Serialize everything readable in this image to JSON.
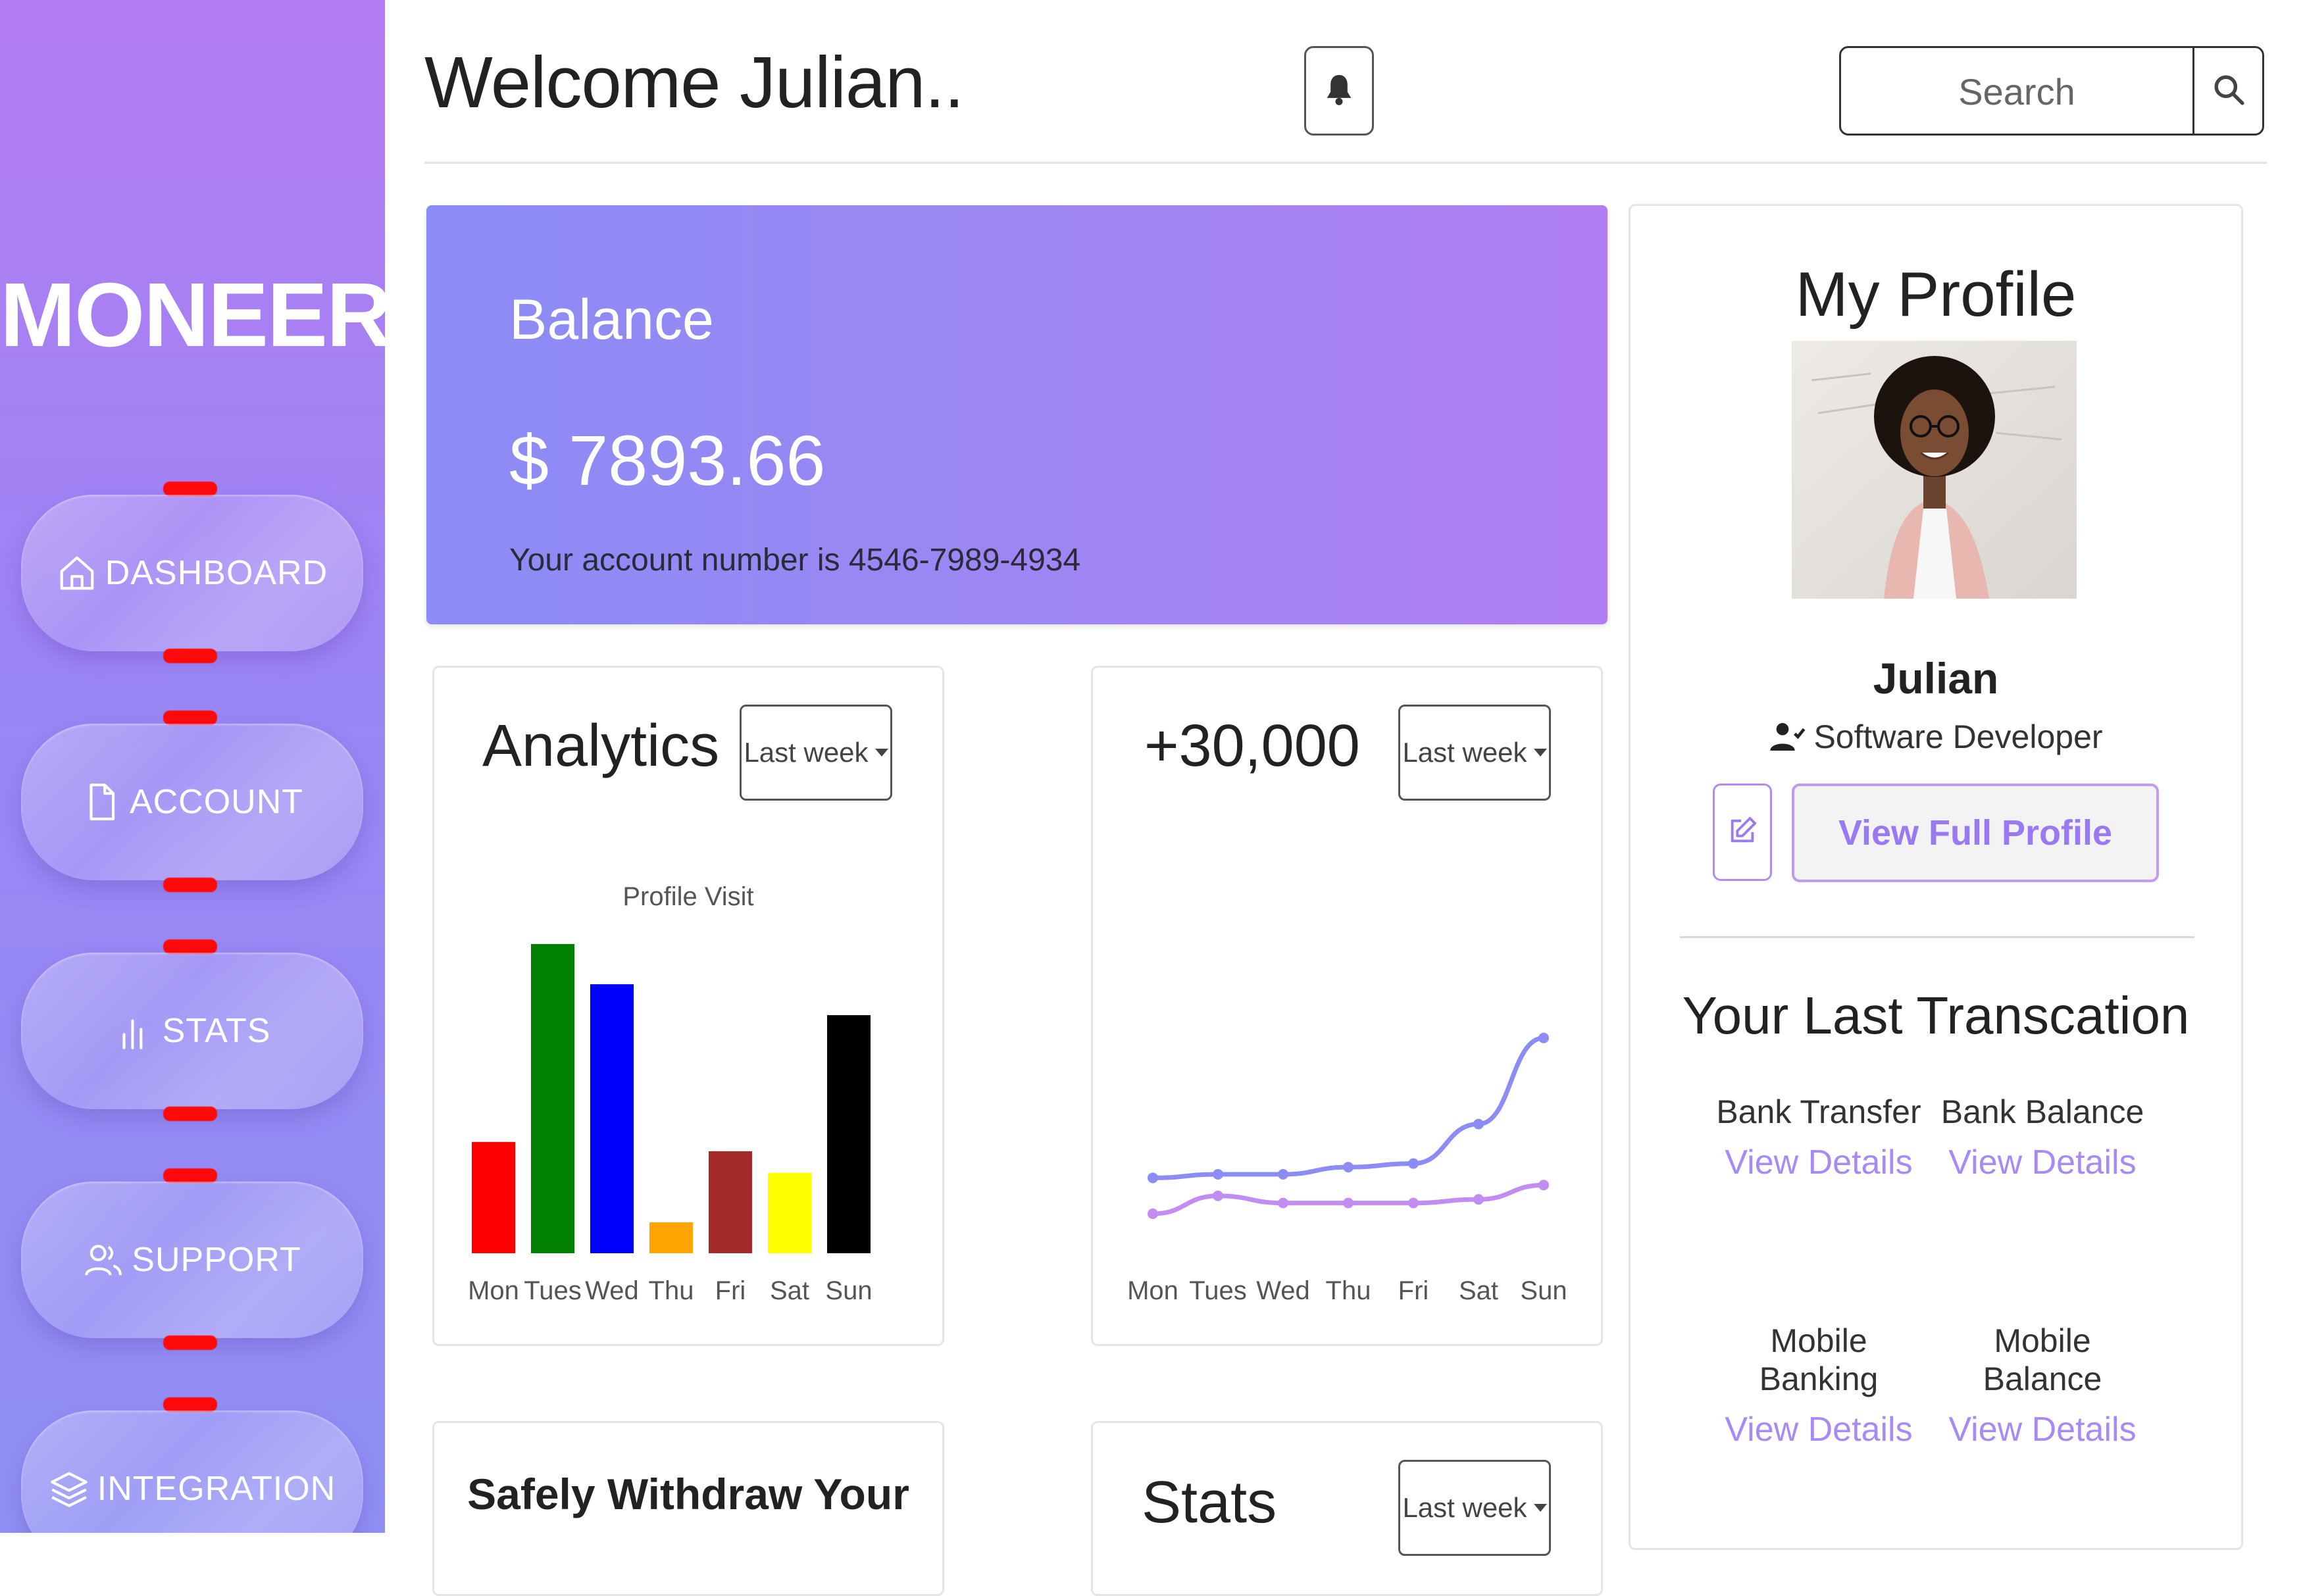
{
  "sidebar": {
    "brand": "MONEER",
    "items": [
      {
        "label": "DASHBOARD",
        "icon": "home-icon"
      },
      {
        "label": "ACCOUNT",
        "icon": "file-icon"
      },
      {
        "label": "STATS",
        "icon": "bar-chart-icon"
      },
      {
        "label": "SUPPORT",
        "icon": "people-icon"
      },
      {
        "label": "INTEGRATION",
        "icon": "layers-icon"
      }
    ]
  },
  "header": {
    "welcome": "Welcome Julian..",
    "search_placeholder": "Search"
  },
  "balance": {
    "title": "Balance",
    "amount": "$ 7893.66",
    "account_text": "Your account number is 4546-7989-4934"
  },
  "analytics": {
    "heading": "Analytics",
    "dropdown": "Last week"
  },
  "trend": {
    "heading": "+30,000",
    "dropdown": "Last week"
  },
  "withdraw": {
    "heading": "Safely Withdraw Your"
  },
  "stats": {
    "heading": "Stats",
    "dropdown": "Last week"
  },
  "profile": {
    "title": "My Profile",
    "name": "Julian",
    "role": "Software Developer",
    "view_button": "View Full Profile",
    "transactions_title": "Your Last Transcation",
    "transactions": [
      {
        "label": "Bank Transfer",
        "link": "View Details"
      },
      {
        "label": "Bank Balance",
        "link": "View Details"
      },
      {
        "label": "Mobile Banking",
        "link": "View Details"
      },
      {
        "label": "Mobile Balance",
        "link": "View Details"
      }
    ]
  },
  "colors": {
    "accent": "#9b79f2",
    "sidebar_top": "#b47cf2",
    "sidebar_bottom": "#8f8ff4",
    "balance_start": "#8b8cf5",
    "balance_end": "#b07ef2",
    "nav_indicator": "#ff0a0a"
  },
  "chart_data": [
    {
      "type": "bar",
      "title": "Profile Visit",
      "categories": [
        "Mon",
        "Tues",
        "Wed",
        "Thu",
        "Fri",
        "Sat",
        "Sun"
      ],
      "values": [
        36,
        100,
        87,
        10,
        33,
        26,
        77
      ],
      "colors": [
        "#ff0000",
        "#008000",
        "#0000ff",
        "#ffa500",
        "#a52a2a",
        "#ffff00",
        "#000000"
      ],
      "ylim": [
        0,
        100
      ],
      "grid": false
    },
    {
      "type": "line",
      "categories": [
        "Mon",
        "Tues",
        "Wed",
        "Thu",
        "Fri",
        "Sat",
        "Sun"
      ],
      "series": [
        {
          "values": [
            10,
            11,
            11,
            13,
            14,
            25,
            49
          ],
          "color": "#8b8cf5"
        },
        {
          "values": [
            0,
            5,
            3,
            3,
            3,
            4,
            8
          ],
          "color": "#c38cf2"
        }
      ],
      "ylim": [
        0,
        55
      ],
      "grid": false
    }
  ]
}
